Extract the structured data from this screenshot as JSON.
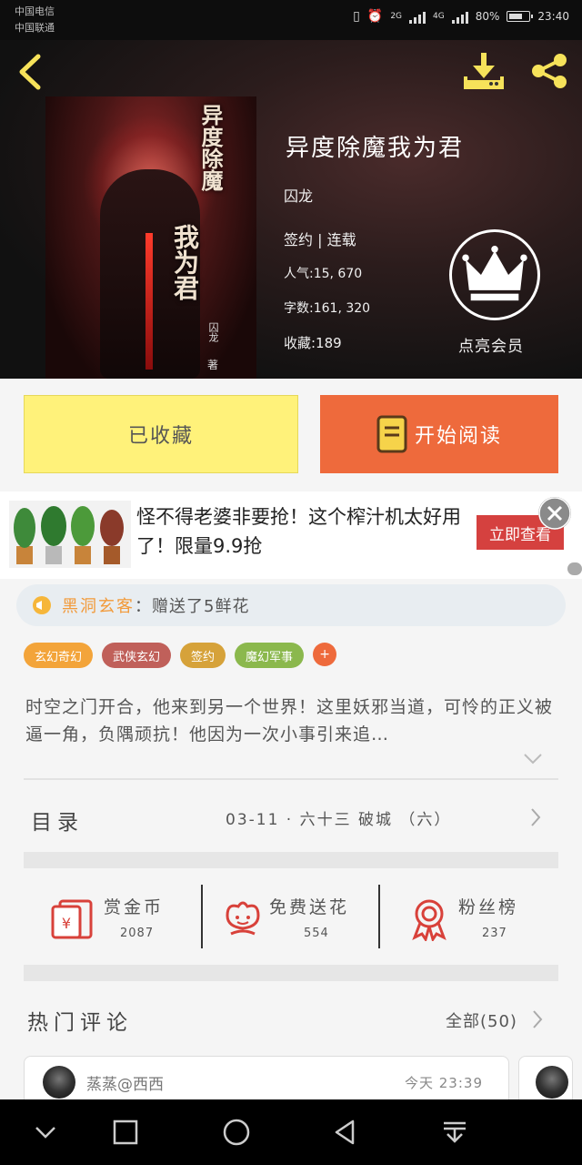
{
  "status_bar": {
    "carrier1": "中国电信",
    "carrier2": "中国联通",
    "net1": "2G",
    "net2": "4G",
    "battery": "80%",
    "time": "23:40"
  },
  "book": {
    "title": "异度除魔我为君",
    "author": "囚龙",
    "status": "签约 | 连载",
    "popularity": "人气:15, 670",
    "words": "字数:161, 320",
    "favorites": "收藏:189",
    "cover_title_1": "异度除魔",
    "cover_title_2": "我为君",
    "cover_author": "囚龙",
    "cover_mark": "著"
  },
  "vip": {
    "label": "点亮会员"
  },
  "actions": {
    "collect_label": "已收藏",
    "read_label": "开始阅读"
  },
  "ad": {
    "text": "怪不得老婆非要抢！这个榨汁机太好用了！限量9.9抢",
    "button": "立即查看"
  },
  "gift": {
    "user": "黑洞玄客",
    "message": "：赠送了5鲜花"
  },
  "tags": [
    {
      "label": "玄幻奇幻",
      "color": "#f3a43a"
    },
    {
      "label": "武侠玄幻",
      "color": "#c0605a"
    },
    {
      "label": "签约",
      "color": "#d6a23a"
    },
    {
      "label": "魔幻军事",
      "color": "#8bb84d"
    }
  ],
  "tag_more": "+",
  "description": "时空之门开合，他来到另一个世界！这里妖邪当道，可怜的正义被逼一角，负隅顽抗！他因为一次小事引来追…",
  "catalog": {
    "label": "目录",
    "latest": "03-11 · 六十三 破城 （六）"
  },
  "stats": [
    {
      "label": "赏金币",
      "value": "2087",
      "icon": "red-envelope-icon"
    },
    {
      "label": "免费送花",
      "value": "554",
      "icon": "flower-icon"
    },
    {
      "label": "粉丝榜",
      "value": "237",
      "icon": "medal-icon"
    }
  ],
  "comments": {
    "label": "热门评论",
    "all": "全部(50)",
    "items": [
      {
        "user": "蒸蒸@西西",
        "time": "今天 23:39"
      }
    ]
  },
  "colors": {
    "accent_orange": "#ee6a3c",
    "collect_yellow": "#fff27a",
    "icon_yellow": "#f6e25a",
    "stat_red": "#d8413a"
  }
}
